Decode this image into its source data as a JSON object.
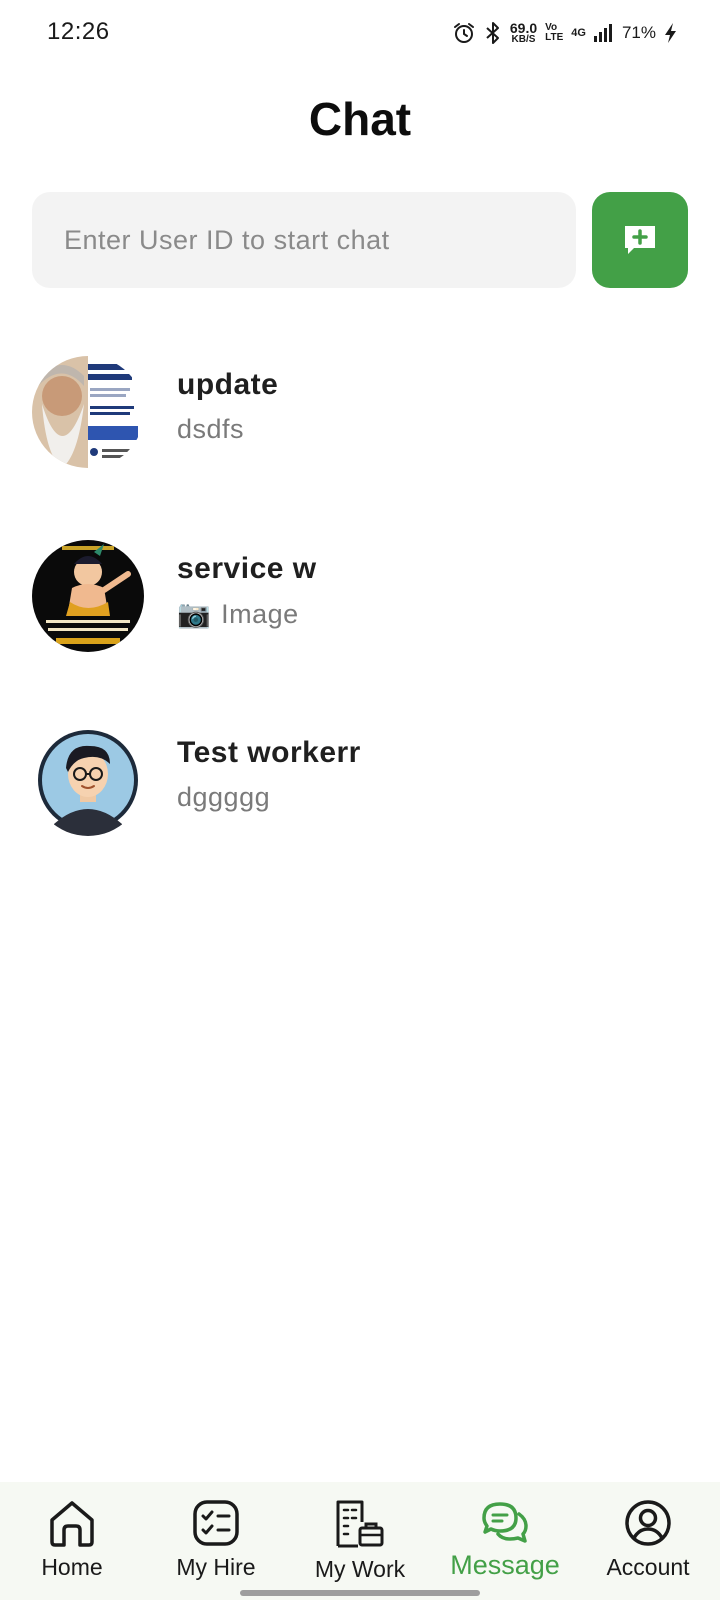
{
  "status_bar": {
    "time": "12:26",
    "speed_value": "69.0",
    "speed_unit": "KB/S",
    "volte_top": "Vo",
    "volte_bottom": "LTE",
    "network": "4G",
    "battery": "71%",
    "icons": [
      "alarm-icon",
      "bluetooth-icon",
      "signal-icon",
      "charging-icon"
    ]
  },
  "header": {
    "title": "Chat"
  },
  "search": {
    "placeholder": "Enter User ID to start chat",
    "value": ""
  },
  "new_chat_button": {
    "icon": "chat-add-icon",
    "color": "#43a047"
  },
  "chats": [
    {
      "name": "update",
      "preview": "dsdfs",
      "avatar": "meditation-workshop-poster"
    },
    {
      "name": "service w",
      "preview_icon": "📷",
      "preview": "Image",
      "avatar": "krishna-illustration"
    },
    {
      "name": "Test workerr",
      "preview": "dggggg",
      "avatar": "cartoon-man-avatar"
    }
  ],
  "bottom_nav": {
    "items": [
      {
        "label": "Home",
        "icon": "home-icon",
        "active": false
      },
      {
        "label": "My Hire",
        "icon": "checklist-icon",
        "active": false
      },
      {
        "label": "My Work",
        "icon": "building-icon",
        "active": false
      },
      {
        "label": "Message",
        "icon": "chat-bubbles-icon",
        "active": true
      },
      {
        "label": "Account",
        "icon": "account-icon",
        "active": false
      }
    ],
    "active_color": "#43a047"
  }
}
